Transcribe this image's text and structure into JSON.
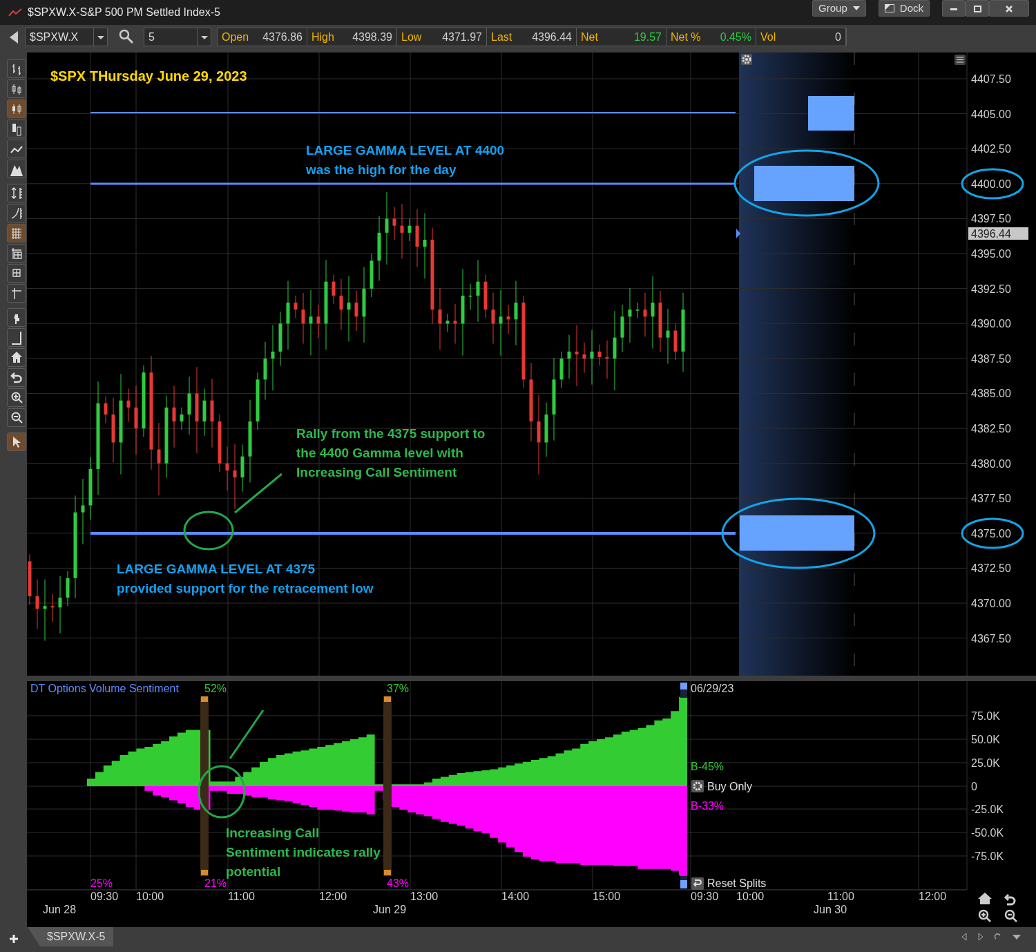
{
  "window": {
    "title": "$SPXW.X-S&P 500 PM Settled Index-5",
    "buttons": [
      "Group",
      "Dock"
    ]
  },
  "toolbar": {
    "symbol": "$SPXW.X",
    "interval": "5",
    "quotes": [
      {
        "label": "Open",
        "value": "4376.86",
        "kind": "price"
      },
      {
        "label": "High",
        "value": "4398.39",
        "kind": "price"
      },
      {
        "label": "Low",
        "value": "4371.97",
        "kind": "price"
      },
      {
        "label": "Last",
        "value": "4396.44",
        "kind": "price"
      },
      {
        "label": "Net",
        "value": "19.57",
        "kind": "change"
      },
      {
        "label": "Net %",
        "value": "0.45%",
        "kind": "change"
      },
      {
        "label": "Vol",
        "value": "0",
        "kind": "price"
      }
    ]
  },
  "side_tools": [
    {
      "selected": false
    },
    {
      "selected": false
    },
    {
      "selected": true
    },
    {
      "selected": false
    },
    {
      "selected": false
    },
    {
      "selected": false
    },
    {
      "selected": false
    },
    {
      "selected": false
    },
    {
      "selected": true
    },
    {
      "selected": false
    },
    {
      "selected": false
    },
    {
      "selected": false
    },
    {
      "selected": false
    },
    {
      "selected": false
    },
    {
      "selected": false
    },
    {
      "selected": false
    },
    {
      "selected": false
    },
    {
      "selected": false
    },
    {
      "selected": true
    }
  ],
  "price_chart": {
    "title": "$SPX THursday June 29, 2023",
    "notes": [
      {
        "kind": "blue",
        "lines": [
          "LARGE GAMMA LEVEL AT 4400",
          "was the high for the day"
        ]
      },
      {
        "kind": "green",
        "lines": [
          "Rally from the 4375 support to",
          "the 4400 Gamma level with",
          "Increasing Call Sentiment"
        ]
      },
      {
        "kind": "blue",
        "lines": [
          "LARGE GAMMA LEVEL AT 4375",
          "provided support for the retracement low"
        ]
      }
    ],
    "price_axis": [
      "4407.50",
      "4405.00",
      "4402.50",
      "4400.00",
      "4397.50",
      "4395.00",
      "4392.50",
      "4390.00",
      "4387.50",
      "4385.00",
      "4382.50",
      "4380.00",
      "4377.50",
      "4375.00",
      "4372.50",
      "4370.00",
      "4367.50"
    ],
    "last_price": "4396.44"
  },
  "sentiment": {
    "title": "DT Options Volume Sentiment",
    "top_labels": [
      "52%",
      "37%"
    ],
    "bottom_labels": [
      "25%",
      "21%",
      "43%"
    ],
    "date": "06/29/23",
    "buy_label": "B-45%",
    "mode_button": "Buy Only",
    "sell_label": "B-33%",
    "reset_button": "Reset Splits",
    "note": [
      "Increasing Call",
      "Sentiment indicates rally",
      "potential"
    ],
    "value_axis": [
      "75.0K",
      "50.0K",
      "25.0K",
      "0",
      "-25.0K",
      "-50.0K",
      "-75.0K"
    ]
  },
  "time_axis": {
    "times": [
      "09:30",
      "10:00",
      "11:00",
      "12:00",
      "13:00",
      "14:00",
      "15:00",
      "09:30",
      "10:00",
      "11:00",
      "12:00"
    ],
    "dates": [
      "Jun 28",
      "Jun 29",
      "Jun 30"
    ]
  },
  "tab_bar": {
    "tabs": [
      {
        "label": "$SPXW.X-5",
        "selected": true
      }
    ]
  }
}
